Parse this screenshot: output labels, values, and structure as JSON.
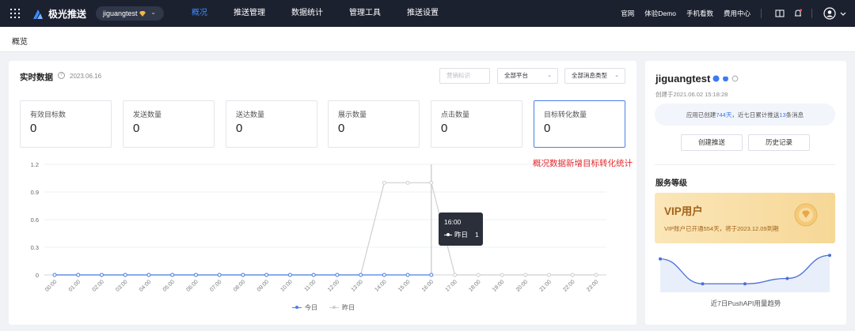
{
  "nav": {
    "logo": "极光推送",
    "app_select": "jiguangtest",
    "items": [
      "概况",
      "推送管理",
      "数据统计",
      "管理工具",
      "推送设置"
    ],
    "active_index": 0,
    "right_links": [
      "官网",
      "体验Demo",
      "手机看数",
      "费用中心"
    ]
  },
  "breadcrumb": "概览",
  "realtime": {
    "title": "实时数据",
    "date": "2023.06.16",
    "filters": {
      "tag_placeholder": "营销标识",
      "platform": "全部平台",
      "msg_type": "全部消息类型"
    },
    "stats": [
      {
        "label": "有效目标数",
        "value": "0"
      },
      {
        "label": "发送数量",
        "value": "0"
      },
      {
        "label": "送达数量",
        "value": "0"
      },
      {
        "label": "展示数量",
        "value": "0"
      },
      {
        "label": "点击数量",
        "value": "0"
      },
      {
        "label": "目标转化数量",
        "value": "0"
      }
    ],
    "annotation": "概况数据新增目标转化统计"
  },
  "chart_data": {
    "type": "line",
    "categories": [
      "00:00",
      "01:00",
      "02:00",
      "03:00",
      "04:00",
      "05:00",
      "06:00",
      "07:00",
      "08:00",
      "09:00",
      "10:00",
      "11:00",
      "12:00",
      "13:00",
      "14:00",
      "15:00",
      "16:00",
      "17:00",
      "18:00",
      "19:00",
      "20:00",
      "21:00",
      "22:00",
      "23:00"
    ],
    "series": [
      {
        "name": "今日",
        "color": "#4a80e8",
        "values": [
          0,
          0,
          0,
          0,
          0,
          0,
          0,
          0,
          0,
          0,
          0,
          0,
          0,
          0,
          0,
          0,
          0,
          null,
          null,
          null,
          null,
          null,
          null,
          null
        ]
      },
      {
        "name": "昨日",
        "color": "#cfcfcf",
        "values": [
          0,
          0,
          0,
          0,
          0,
          0,
          0,
          0,
          0,
          0,
          0,
          0,
          0,
          0,
          1,
          1,
          1,
          0,
          0,
          0,
          0,
          0,
          0,
          0
        ]
      }
    ],
    "y_ticks": [
      "0",
      "0.3",
      "0.6",
      "0.9",
      "1.2"
    ],
    "ylim": [
      0,
      1.2
    ],
    "hover_index": 16,
    "tooltip": {
      "time": "16:00",
      "series": "昨日",
      "value": "1"
    }
  },
  "app_card": {
    "name": "jiguangtest",
    "created": "创建于2021.06.02 15:18:28",
    "info_prefix": "应用已创建",
    "days": "744天",
    "info_mid": "，近七日累计推送",
    "count": "13",
    "info_suffix": "条消息",
    "btn_create": "创建推送",
    "btn_history": "历史记录",
    "service_level": "服务等级",
    "vip_title": "VIP用户",
    "vip_desc": "VIP账户已开通554天，将于2023.12.09到期",
    "trend_label": "近7日PushAPI用量趋势",
    "trend": [
      0.85,
      0.15,
      0.15,
      0.3,
      0.95
    ]
  }
}
